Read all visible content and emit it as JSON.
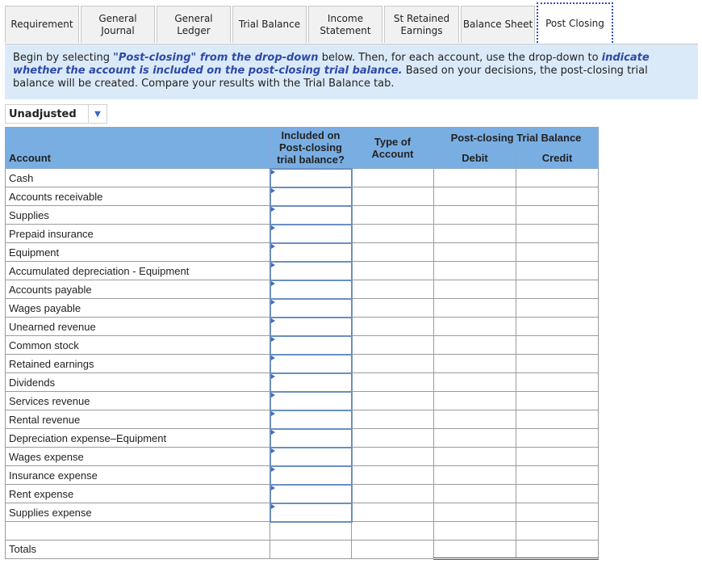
{
  "tabs": [
    {
      "label": "Requirement",
      "active": false
    },
    {
      "label": "General Journal",
      "active": false
    },
    {
      "label": "General Ledger",
      "active": false
    },
    {
      "label": "Trial Balance",
      "active": false
    },
    {
      "label": "Income Statement",
      "active": false
    },
    {
      "label": "St Retained Earnings",
      "active": false
    },
    {
      "label": "Balance Sheet",
      "active": false
    },
    {
      "label": "Post Closing",
      "active": true
    }
  ],
  "instructions": {
    "p1": "Begin by selecting ",
    "em1": "\"Post-closing\" from the drop-down",
    "p2": " below.  Then, for each account, use the drop-down to ",
    "em2": "indicate whether the account is included on the post-closing trial balance.",
    "p3": "  Based on your decisions, the post-closing trial balance will be created.  Compare your results with the Trial Balance tab."
  },
  "balance_type_dropdown": {
    "value": "Unadjusted"
  },
  "table": {
    "headers": {
      "account": "Account",
      "included": "Included on Post-closing trial balance?",
      "type": "Type of Account",
      "group": "Post-closing Trial Balance",
      "debit": "Debit",
      "credit": "Credit"
    },
    "rows": [
      "Cash",
      "Accounts receivable",
      "Supplies",
      "Prepaid insurance",
      "Equipment",
      "Accumulated depreciation - Equipment",
      "Accounts payable",
      "Wages payable",
      "Unearned revenue",
      "Common stock",
      "Retained earnings",
      "Dividends",
      "Services revenue",
      "Rental revenue",
      "Depreciation expense–Equipment",
      "Wages expense",
      "Insurance expense",
      "Rent expense",
      "Supplies expense"
    ],
    "totals_label": "Totals"
  }
}
